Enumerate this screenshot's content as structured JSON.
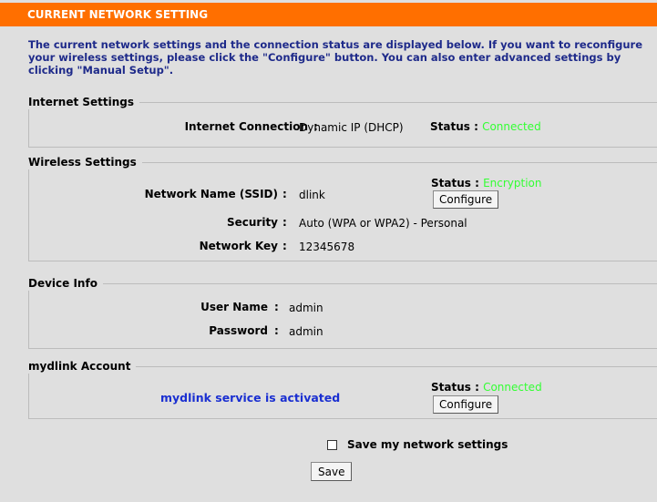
{
  "header": {
    "title": "CURRENT NETWORK SETTING"
  },
  "intro": "The current network settings and the connection status are displayed below. If you want to reconfigure your wireless settings, please click the \"Configure\" button. You can also enter advanced settings by clicking \"Manual Setup\".",
  "internet": {
    "legend": "Internet Settings",
    "connection_label": "Internet Connection",
    "connection_value": "Dynamic IP (DHCP)",
    "status_label": "Status :",
    "status_value": "Connected"
  },
  "wireless": {
    "legend": "Wireless Settings",
    "ssid_label": "Network Name (SSID)",
    "ssid_value": "dlink",
    "status_label": "Status :",
    "status_value": "Encryption",
    "configure_label": "Configure",
    "security_label": "Security",
    "security_value": "Auto (WPA or WPA2) - Personal",
    "key_label": "Network Key",
    "key_value": "12345678"
  },
  "device": {
    "legend": "Device Info",
    "user_label": "User Name",
    "user_value": "admin",
    "password_label": "Password",
    "password_value": "admin"
  },
  "mydlink": {
    "legend": "mydlink Account",
    "message": "mydlink service is activated",
    "status_label": "Status :",
    "status_value": "Connected",
    "configure_label": "Configure"
  },
  "save": {
    "checkbox_label": "Save my network settings",
    "button_label": "Save"
  },
  "colon": ":",
  "colors": {
    "header_bg": "#ff6f00",
    "status_green": "#33ff33",
    "intro_blue": "#1e2a8a",
    "mydlink_blue": "#1a2fd1"
  }
}
